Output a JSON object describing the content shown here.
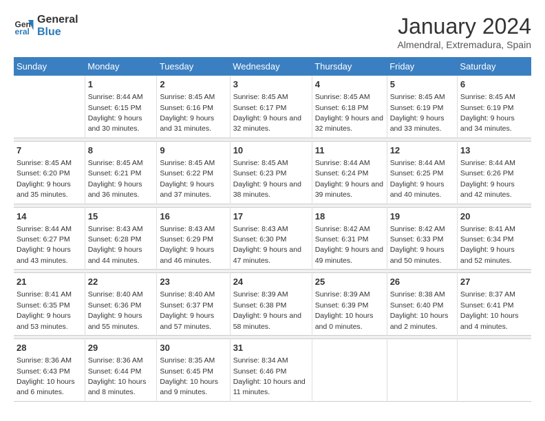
{
  "header": {
    "logo_line1": "General",
    "logo_line2": "Blue",
    "title": "January 2024",
    "subtitle": "Almendral, Extremadura, Spain"
  },
  "columns": [
    "Sunday",
    "Monday",
    "Tuesday",
    "Wednesday",
    "Thursday",
    "Friday",
    "Saturday"
  ],
  "weeks": [
    {
      "days": [
        {
          "num": "",
          "sunrise": "",
          "sunset": "",
          "daylight": ""
        },
        {
          "num": "1",
          "sunrise": "Sunrise: 8:44 AM",
          "sunset": "Sunset: 6:15 PM",
          "daylight": "Daylight: 9 hours and 30 minutes."
        },
        {
          "num": "2",
          "sunrise": "Sunrise: 8:45 AM",
          "sunset": "Sunset: 6:16 PM",
          "daylight": "Daylight: 9 hours and 31 minutes."
        },
        {
          "num": "3",
          "sunrise": "Sunrise: 8:45 AM",
          "sunset": "Sunset: 6:17 PM",
          "daylight": "Daylight: 9 hours and 32 minutes."
        },
        {
          "num": "4",
          "sunrise": "Sunrise: 8:45 AM",
          "sunset": "Sunset: 6:18 PM",
          "daylight": "Daylight: 9 hours and 32 minutes."
        },
        {
          "num": "5",
          "sunrise": "Sunrise: 8:45 AM",
          "sunset": "Sunset: 6:19 PM",
          "daylight": "Daylight: 9 hours and 33 minutes."
        },
        {
          "num": "6",
          "sunrise": "Sunrise: 8:45 AM",
          "sunset": "Sunset: 6:19 PM",
          "daylight": "Daylight: 9 hours and 34 minutes."
        }
      ]
    },
    {
      "days": [
        {
          "num": "7",
          "sunrise": "Sunrise: 8:45 AM",
          "sunset": "Sunset: 6:20 PM",
          "daylight": "Daylight: 9 hours and 35 minutes."
        },
        {
          "num": "8",
          "sunrise": "Sunrise: 8:45 AM",
          "sunset": "Sunset: 6:21 PM",
          "daylight": "Daylight: 9 hours and 36 minutes."
        },
        {
          "num": "9",
          "sunrise": "Sunrise: 8:45 AM",
          "sunset": "Sunset: 6:22 PM",
          "daylight": "Daylight: 9 hours and 37 minutes."
        },
        {
          "num": "10",
          "sunrise": "Sunrise: 8:45 AM",
          "sunset": "Sunset: 6:23 PM",
          "daylight": "Daylight: 9 hours and 38 minutes."
        },
        {
          "num": "11",
          "sunrise": "Sunrise: 8:44 AM",
          "sunset": "Sunset: 6:24 PM",
          "daylight": "Daylight: 9 hours and 39 minutes."
        },
        {
          "num": "12",
          "sunrise": "Sunrise: 8:44 AM",
          "sunset": "Sunset: 6:25 PM",
          "daylight": "Daylight: 9 hours and 40 minutes."
        },
        {
          "num": "13",
          "sunrise": "Sunrise: 8:44 AM",
          "sunset": "Sunset: 6:26 PM",
          "daylight": "Daylight: 9 hours and 42 minutes."
        }
      ]
    },
    {
      "days": [
        {
          "num": "14",
          "sunrise": "Sunrise: 8:44 AM",
          "sunset": "Sunset: 6:27 PM",
          "daylight": "Daylight: 9 hours and 43 minutes."
        },
        {
          "num": "15",
          "sunrise": "Sunrise: 8:43 AM",
          "sunset": "Sunset: 6:28 PM",
          "daylight": "Daylight: 9 hours and 44 minutes."
        },
        {
          "num": "16",
          "sunrise": "Sunrise: 8:43 AM",
          "sunset": "Sunset: 6:29 PM",
          "daylight": "Daylight: 9 hours and 46 minutes."
        },
        {
          "num": "17",
          "sunrise": "Sunrise: 8:43 AM",
          "sunset": "Sunset: 6:30 PM",
          "daylight": "Daylight: 9 hours and 47 minutes."
        },
        {
          "num": "18",
          "sunrise": "Sunrise: 8:42 AM",
          "sunset": "Sunset: 6:31 PM",
          "daylight": "Daylight: 9 hours and 49 minutes."
        },
        {
          "num": "19",
          "sunrise": "Sunrise: 8:42 AM",
          "sunset": "Sunset: 6:33 PM",
          "daylight": "Daylight: 9 hours and 50 minutes."
        },
        {
          "num": "20",
          "sunrise": "Sunrise: 8:41 AM",
          "sunset": "Sunset: 6:34 PM",
          "daylight": "Daylight: 9 hours and 52 minutes."
        }
      ]
    },
    {
      "days": [
        {
          "num": "21",
          "sunrise": "Sunrise: 8:41 AM",
          "sunset": "Sunset: 6:35 PM",
          "daylight": "Daylight: 9 hours and 53 minutes."
        },
        {
          "num": "22",
          "sunrise": "Sunrise: 8:40 AM",
          "sunset": "Sunset: 6:36 PM",
          "daylight": "Daylight: 9 hours and 55 minutes."
        },
        {
          "num": "23",
          "sunrise": "Sunrise: 8:40 AM",
          "sunset": "Sunset: 6:37 PM",
          "daylight": "Daylight: 9 hours and 57 minutes."
        },
        {
          "num": "24",
          "sunrise": "Sunrise: 8:39 AM",
          "sunset": "Sunset: 6:38 PM",
          "daylight": "Daylight: 9 hours and 58 minutes."
        },
        {
          "num": "25",
          "sunrise": "Sunrise: 8:39 AM",
          "sunset": "Sunset: 6:39 PM",
          "daylight": "Daylight: 10 hours and 0 minutes."
        },
        {
          "num": "26",
          "sunrise": "Sunrise: 8:38 AM",
          "sunset": "Sunset: 6:40 PM",
          "daylight": "Daylight: 10 hours and 2 minutes."
        },
        {
          "num": "27",
          "sunrise": "Sunrise: 8:37 AM",
          "sunset": "Sunset: 6:41 PM",
          "daylight": "Daylight: 10 hours and 4 minutes."
        }
      ]
    },
    {
      "days": [
        {
          "num": "28",
          "sunrise": "Sunrise: 8:36 AM",
          "sunset": "Sunset: 6:43 PM",
          "daylight": "Daylight: 10 hours and 6 minutes."
        },
        {
          "num": "29",
          "sunrise": "Sunrise: 8:36 AM",
          "sunset": "Sunset: 6:44 PM",
          "daylight": "Daylight: 10 hours and 8 minutes."
        },
        {
          "num": "30",
          "sunrise": "Sunrise: 8:35 AM",
          "sunset": "Sunset: 6:45 PM",
          "daylight": "Daylight: 10 hours and 9 minutes."
        },
        {
          "num": "31",
          "sunrise": "Sunrise: 8:34 AM",
          "sunset": "Sunset: 6:46 PM",
          "daylight": "Daylight: 10 hours and 11 minutes."
        },
        {
          "num": "",
          "sunrise": "",
          "sunset": "",
          "daylight": ""
        },
        {
          "num": "",
          "sunrise": "",
          "sunset": "",
          "daylight": ""
        },
        {
          "num": "",
          "sunrise": "",
          "sunset": "",
          "daylight": ""
        }
      ]
    }
  ]
}
